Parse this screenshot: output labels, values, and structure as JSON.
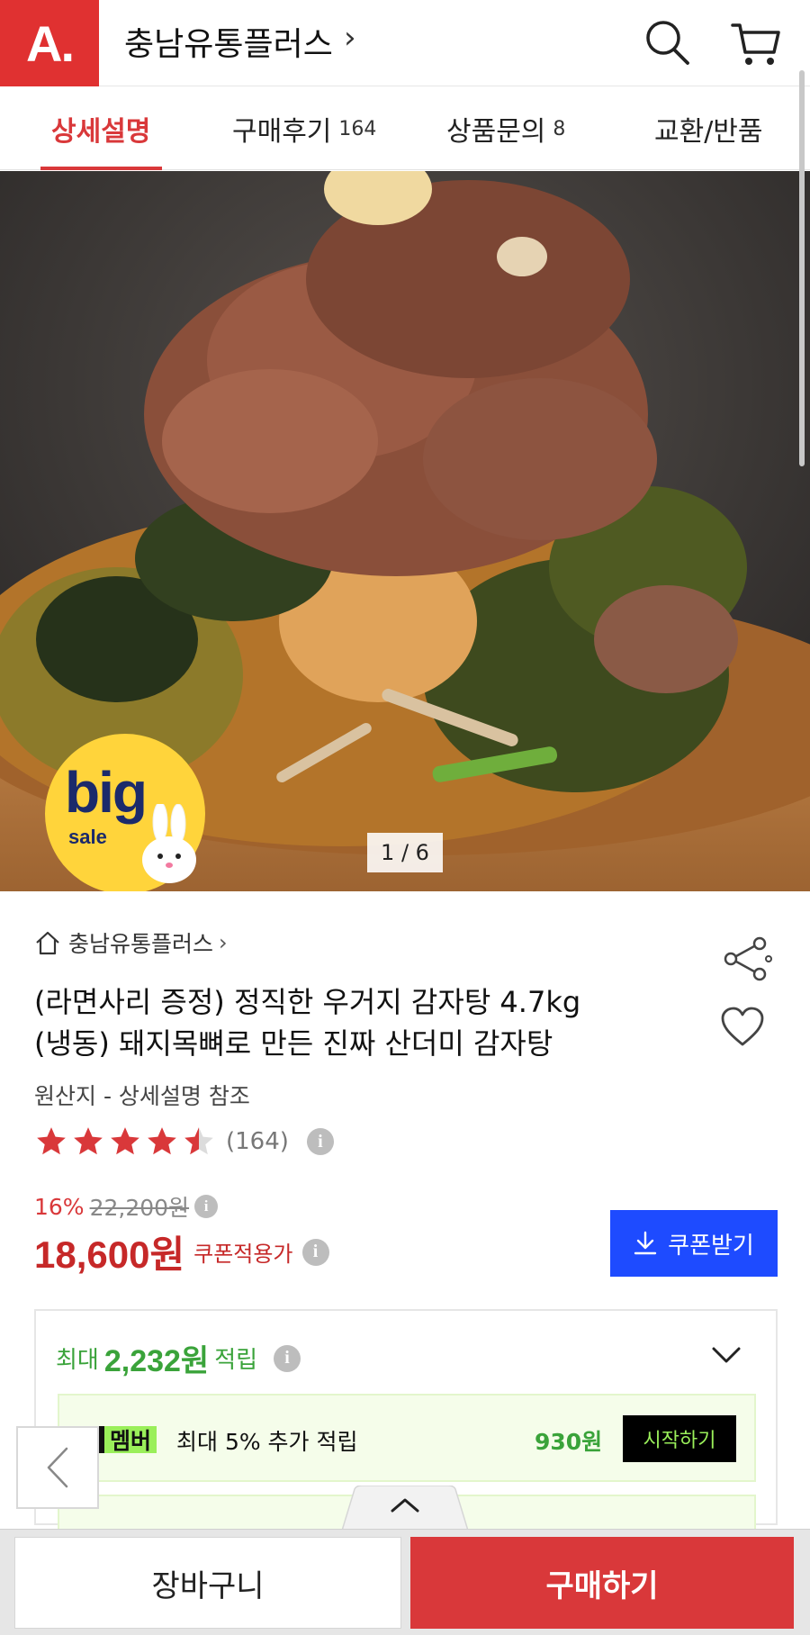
{
  "header": {
    "logo": "A.",
    "store_name": "충남유통플러스",
    "store_chevron": "›",
    "icons": [
      "search-icon",
      "cart-icon"
    ]
  },
  "tabs": [
    {
      "label": "상세설명",
      "count": ""
    },
    {
      "label": "구매후기",
      "count": "164"
    },
    {
      "label": "상품문의",
      "count": "8"
    },
    {
      "label": "교환/반품",
      "count": ""
    }
  ],
  "hero": {
    "badge_big": "big",
    "badge_sale": "sale",
    "pager": "1 / 6"
  },
  "product": {
    "breadcrumb": "충남유통플러스",
    "title_line1": "(라면사리 증정) 정직한 우거지 감자탕 4.7kg",
    "title_line2": "(냉동) 돼지목뼈로 만든 진짜 산더미 감자탕",
    "origin": "원산지 - 상세설명 참조",
    "rating": 4.5,
    "review_count": "(164)",
    "discount_pct": "16%",
    "original_price": "22,200원",
    "price": "18,600원",
    "price_label": "쿠폰적용가",
    "coupon_label": "쿠폰받기"
  },
  "reward": {
    "prefix": "최대",
    "amount": "2,232원",
    "suffix": "적립",
    "member_badge": "멤버",
    "member_text": "최대 5% 추가 적립",
    "member_amount": "930원",
    "start_label": "시작하기"
  },
  "bottom": {
    "cart_label": "장바구니",
    "buy_label": "구매하기"
  },
  "colors": {
    "brand_red": "#d9383a",
    "coupon_blue": "#1e4bff",
    "reward_green": "#3aa33a",
    "star_red": "#d9383a"
  }
}
